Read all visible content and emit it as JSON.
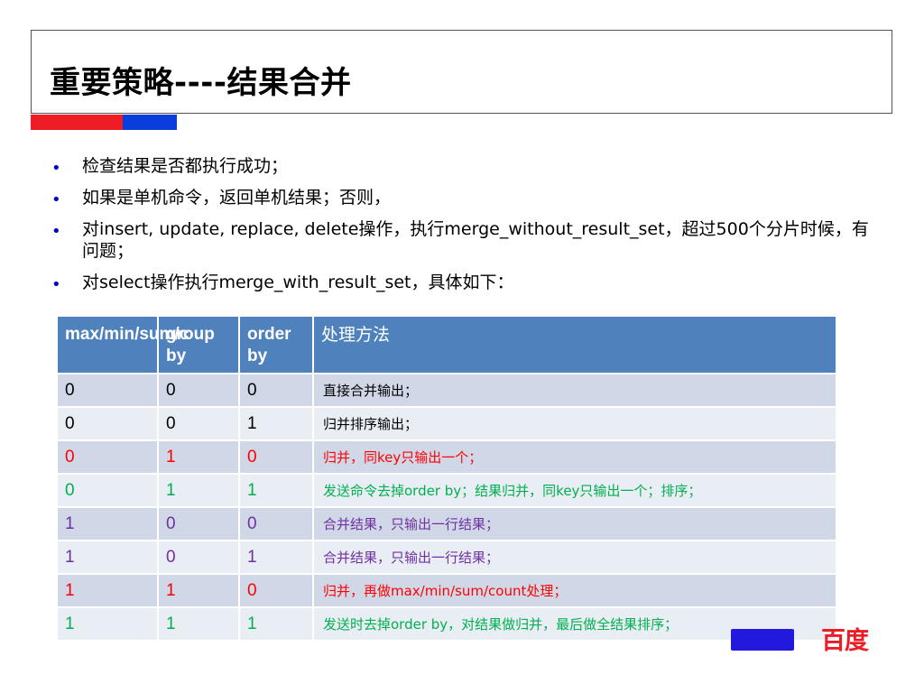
{
  "slide": {
    "title": "重要策略----结果合并"
  },
  "bullets": [
    "检查结果是否都执行成功；",
    "如果是单机命令，返回单机结果；否则，",
    "对insert, update, replace, delete操作，执行merge_without_result_set，超过500个分片时候，有问题；",
    "对select操作执行merge_with_result_set，具体如下："
  ],
  "table": {
    "headers": [
      "max/min/sum/c",
      "group by",
      "order by",
      "处理方法"
    ],
    "rows": [
      {
        "cells": [
          "0",
          "0",
          "0",
          "直接合并输出；"
        ],
        "color": "#000000"
      },
      {
        "cells": [
          "0",
          "0",
          "1",
          "归并排序输出；"
        ],
        "color": "#000000"
      },
      {
        "cells": [
          "0",
          "1",
          "0",
          "归并，同key只输出一个；"
        ],
        "color": "#ff0000"
      },
      {
        "cells": [
          "0",
          "1",
          "1",
          "发送命令去掉order by；结果归并，同key只输出一个；排序；"
        ],
        "color": "#00b050"
      },
      {
        "cells": [
          "1",
          "0",
          "0",
          "合并结果，只输出一行结果；"
        ],
        "color": "#7030a0"
      },
      {
        "cells": [
          "1",
          "0",
          "1",
          "合并结果，只输出一行结果；"
        ],
        "color": "#7030a0"
      },
      {
        "cells": [
          "1",
          "1",
          "0",
          "归并，再做max/min/sum/count处理；"
        ],
        "color": "#ff0000"
      },
      {
        "cells": [
          "1",
          "1",
          "1",
          "发送时去掉order by，对结果做归并，最后做全结果排序；"
        ],
        "color": "#00b050"
      }
    ]
  },
  "logo": {
    "text": "百度"
  },
  "colors": {
    "header_bg": "#4f81bd",
    "row_odd_bg": "#d0d8e8",
    "row_even_bg": "#e9edf4",
    "accent_red": "#ee1c24",
    "accent_blue": "#0a3ddb",
    "bullet_color": "#0000cc"
  }
}
